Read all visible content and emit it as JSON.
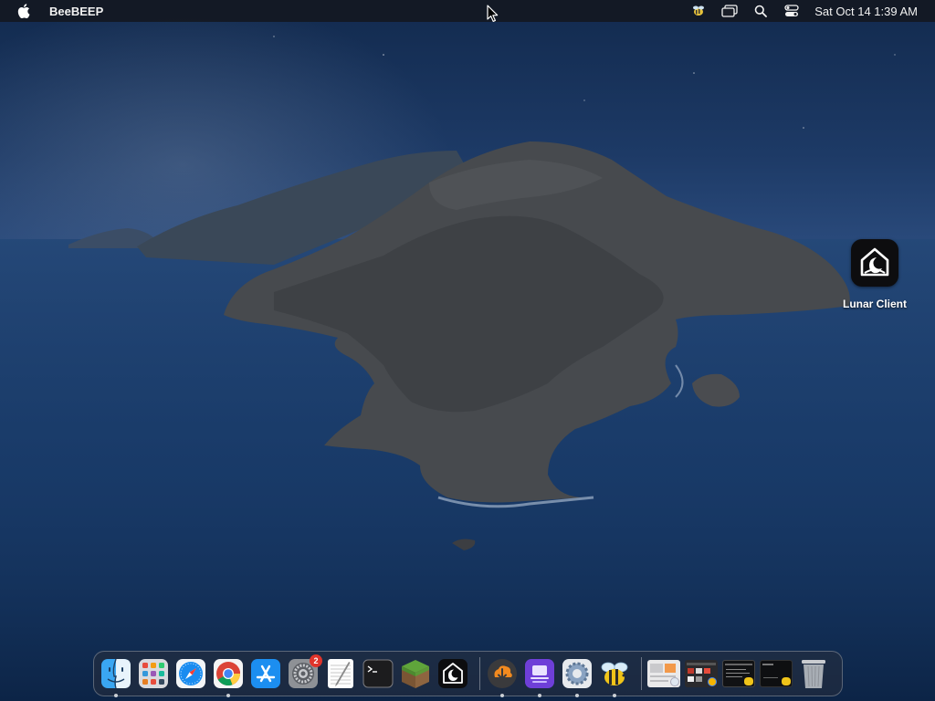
{
  "menubar": {
    "app_name": "BeeBEEP",
    "clock": "Sat Oct 14  1:39 AM",
    "status_icons": [
      "beebeep-status-icon",
      "screen-mirroring-icon",
      "spotlight-search-icon",
      "control-center-icon"
    ]
  },
  "desktop": {
    "icons": [
      {
        "label": "Lunar Client",
        "icon": "lunar-client-icon"
      }
    ]
  },
  "dock": {
    "apps": [
      {
        "name": "Finder",
        "icon": "finder-icon",
        "running": true
      },
      {
        "name": "Launchpad",
        "icon": "launchpad-icon",
        "running": false
      },
      {
        "name": "Safari",
        "icon": "safari-icon",
        "running": false
      },
      {
        "name": "Google Chrome",
        "icon": "chrome-icon",
        "running": true
      },
      {
        "name": "App Store",
        "icon": "app-store-icon",
        "running": false
      },
      {
        "name": "System Preferences",
        "icon": "system-preferences-icon",
        "running": false,
        "badge": "2"
      },
      {
        "name": "TextEdit",
        "icon": "textedit-icon",
        "running": false
      },
      {
        "name": "Terminal",
        "icon": "terminal-icon",
        "running": false
      },
      {
        "name": "Minecraft",
        "icon": "minecraft-icon",
        "running": false
      },
      {
        "name": "Lunar Client",
        "icon": "lunar-client-icon",
        "running": false
      }
    ],
    "recent": [
      {
        "name": "Downloader",
        "icon": "download-icon",
        "running": true
      },
      {
        "name": "Setapp",
        "icon": "setapp-icon",
        "running": true
      },
      {
        "name": "Settings Utility",
        "icon": "gear-utility-icon",
        "running": true
      },
      {
        "name": "BeeBEEP",
        "icon": "beebeep-icon",
        "running": true
      }
    ],
    "minimized": [
      "window-thumbnail-1",
      "window-thumbnail-2",
      "window-thumbnail-3",
      "window-thumbnail-4"
    ],
    "trash": "trash-icon"
  },
  "colors": {
    "menubar_bg": "#14182299",
    "badge_red": "#e0342b"
  }
}
